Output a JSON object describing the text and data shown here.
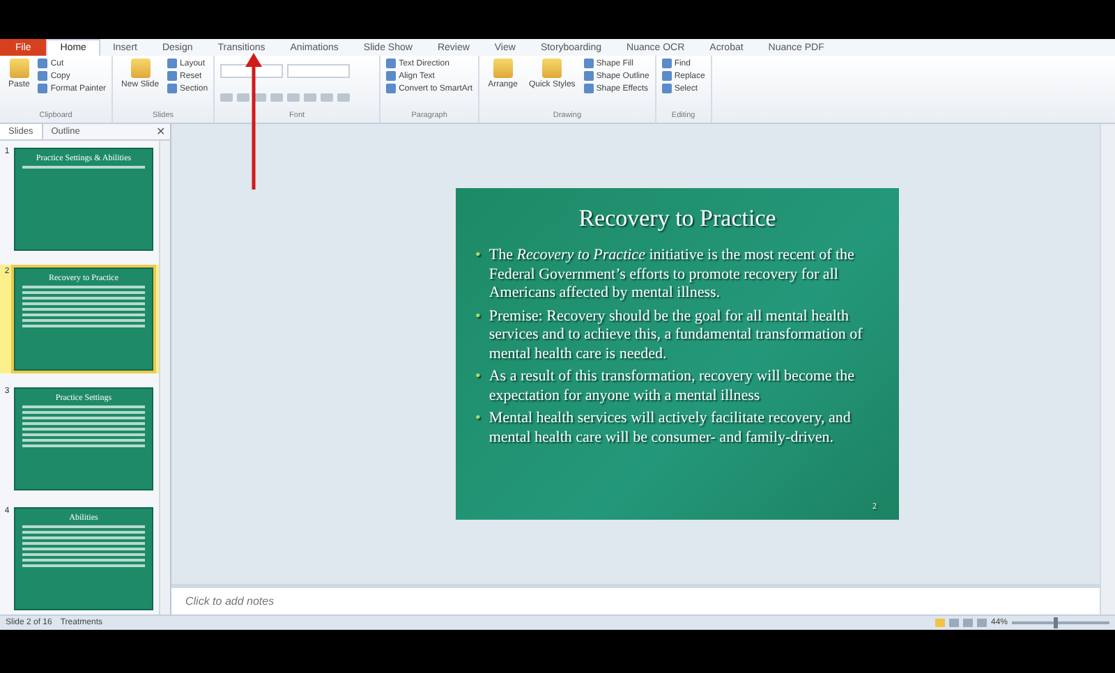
{
  "ribbon_tabs": [
    {
      "label": "File",
      "selected": false,
      "kind": "file"
    },
    {
      "label": "Home",
      "selected": true,
      "kind": "tab"
    },
    {
      "label": "Insert",
      "selected": false,
      "kind": "tab"
    },
    {
      "label": "Design",
      "selected": false,
      "kind": "tab"
    },
    {
      "label": "Transitions",
      "selected": false,
      "kind": "tab"
    },
    {
      "label": "Animations",
      "selected": false,
      "kind": "tab"
    },
    {
      "label": "Slide Show",
      "selected": false,
      "kind": "tab"
    },
    {
      "label": "Review",
      "selected": false,
      "kind": "tab"
    },
    {
      "label": "View",
      "selected": false,
      "kind": "tab"
    },
    {
      "label": "Storyboarding",
      "selected": false,
      "kind": "tab"
    },
    {
      "label": "Nuance OCR",
      "selected": false,
      "kind": "tab"
    },
    {
      "label": "Acrobat",
      "selected": false,
      "kind": "tab"
    },
    {
      "label": "Nuance PDF",
      "selected": false,
      "kind": "tab"
    }
  ],
  "ribbon_groups": [
    {
      "name": "Clipboard",
      "big": [
        "Paste"
      ],
      "small": [
        "Cut",
        "Copy",
        "Format Painter"
      ]
    },
    {
      "name": "Slides",
      "big": [
        "New Slide"
      ],
      "small": [
        "Layout",
        "Reset",
        "Section"
      ]
    },
    {
      "name": "Font",
      "kind": "font"
    },
    {
      "name": "Paragraph",
      "small": [
        "Text Direction",
        "Align Text",
        "Convert to SmartArt"
      ]
    },
    {
      "name": "Drawing",
      "big": [
        "Arrange",
        "Quick Styles"
      ],
      "small": [
        "Shape Fill",
        "Shape Outline",
        "Shape Effects"
      ]
    },
    {
      "name": "Editing",
      "small": [
        "Find",
        "Replace",
        "Select"
      ]
    }
  ],
  "pane_tabs": [
    {
      "label": "Slides",
      "selected": true
    },
    {
      "label": "Outline",
      "selected": false
    }
  ],
  "pane_close": "✕",
  "thumbnails": [
    {
      "number": "1",
      "title": "Practice Settings & Abilities",
      "selected": false,
      "kind": "title"
    },
    {
      "number": "2",
      "title": "Recovery to Practice",
      "selected": true,
      "kind": "content"
    },
    {
      "number": "3",
      "title": "Practice Settings",
      "selected": false,
      "kind": "content"
    },
    {
      "number": "4",
      "title": "Abilities",
      "selected": false,
      "kind": "content"
    }
  ],
  "slide": {
    "title": "Recovery to Practice",
    "bullet_marker": "•",
    "bullets": [
      "The *Recovery to Practice* initiative is the most recent of the Federal Government’s efforts to promote recovery for all Americans affected by mental illness.",
      "Premise: Recovery should be the goal for all mental health services and to achieve this, a fundamental transformation of mental health care is needed.",
      "As a result of this transformation, recovery will become the expectation for anyone with a mental illness",
      "Mental health services will actively facilitate recovery, and mental health care will be consumer- and family-driven."
    ],
    "number": "2"
  },
  "notes": {
    "placeholder": "Click to add notes"
  },
  "status_bar": {
    "slide_count": "Slide 2 of 16",
    "theme": "Treatments",
    "zoom": "44%",
    "level": 0.45
  }
}
